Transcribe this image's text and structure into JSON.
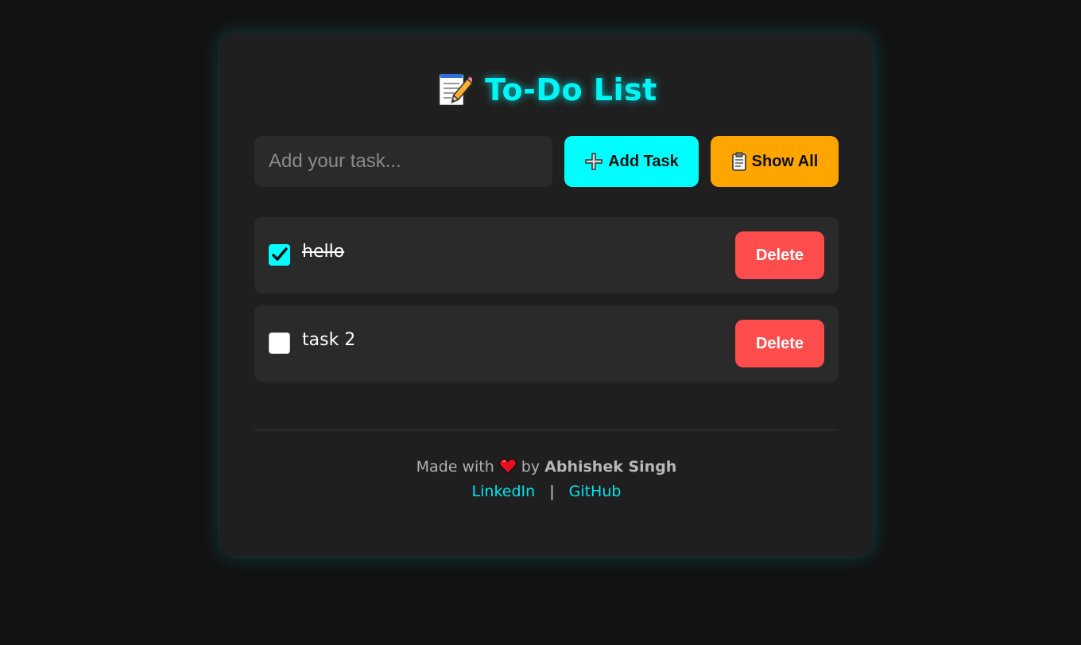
{
  "header": {
    "title": "To-Do List",
    "icon": "memo-icon"
  },
  "input": {
    "placeholder": "Add your task...",
    "value": ""
  },
  "buttons": {
    "add_label": "Add Task",
    "add_icon": "plus-icon",
    "show_all_label": "Show All",
    "show_all_icon": "clipboard-icon"
  },
  "tasks": [
    {
      "text": "hello",
      "completed": true,
      "delete_label": "Delete"
    },
    {
      "text": "task 2",
      "completed": false,
      "delete_label": "Delete"
    }
  ],
  "footer": {
    "made_with": "Made with",
    "heart_icon": "heart-icon",
    "by": "by",
    "author": "Abhishek Singh",
    "links": [
      {
        "label": "LinkedIn"
      },
      {
        "label": "GitHub"
      }
    ],
    "separator": "|"
  },
  "colors": {
    "background": "#121212",
    "card": "#1f1f1f",
    "accent": "#00ffff",
    "show_all": "#ffa500",
    "delete": "#ff4d4d"
  }
}
